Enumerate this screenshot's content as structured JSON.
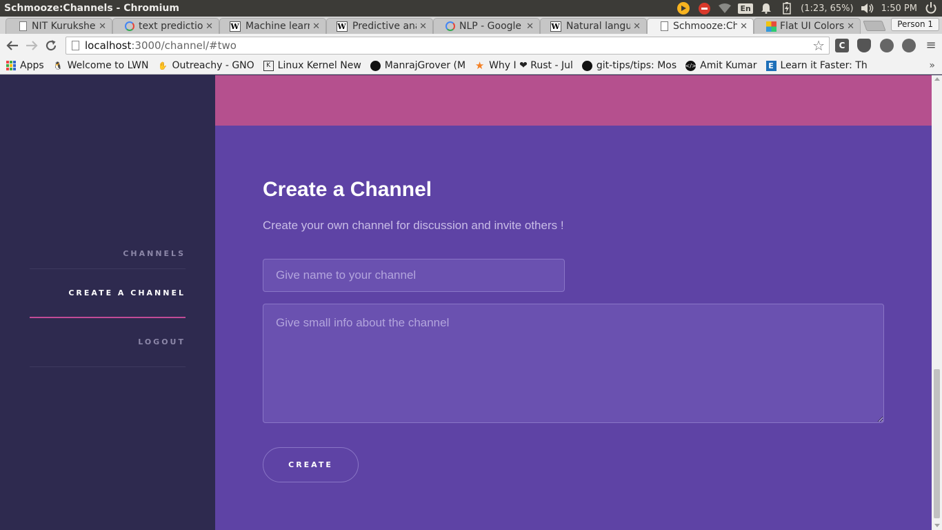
{
  "os": {
    "window_title": "Schmooze:Channels - Chromium",
    "keyboard_layout": "En",
    "battery": "(1:23, 65%)",
    "clock": "1:50 PM",
    "icons": [
      "chrome-icon",
      "stop-icon",
      "wifi-icon",
      "keyboard-icon",
      "bell-icon",
      "battery-icon",
      "volume-icon",
      "power-icon"
    ]
  },
  "browser": {
    "tabs": [
      {
        "title": "NIT Kurukshetr",
        "favicon": "doc-icon",
        "active": false
      },
      {
        "title": "text prediction",
        "favicon": "google-icon",
        "active": false
      },
      {
        "title": "Machine learni",
        "favicon": "wikipedia-icon",
        "active": false
      },
      {
        "title": "Predictive anal",
        "favicon": "wikipedia-icon",
        "active": false
      },
      {
        "title": "NLP - Google S",
        "favicon": "google-icon",
        "active": false
      },
      {
        "title": "Natural langua",
        "favicon": "wikipedia-icon",
        "active": false
      },
      {
        "title": "Schmooze:Cha",
        "favicon": "doc-icon",
        "active": true
      },
      {
        "title": "Flat UI Colors -",
        "favicon": "flatui-icon",
        "active": false
      }
    ],
    "profile": "Person 1",
    "url_host": "localhost",
    "url_path": ":3000/channel/#two",
    "extensions": [
      "C",
      "pocket",
      "circle",
      "circle"
    ],
    "bookmarks": [
      {
        "label": "Apps",
        "icon": "apps-icon"
      },
      {
        "label": "Welcome to LWN",
        "icon": "tux-icon"
      },
      {
        "label": "Outreachy - GNO",
        "icon": "gnome-icon"
      },
      {
        "label": "Linux Kernel New",
        "icon": "kernelnewbies-icon"
      },
      {
        "label": "ManrajGrover (M",
        "icon": "github-icon"
      },
      {
        "label": "Why I ❤ Rust - Jul",
        "icon": "star-icon"
      },
      {
        "label": "git-tips/tips: Mos",
        "icon": "github-icon"
      },
      {
        "label": "Amit Kumar",
        "icon": "code-icon"
      },
      {
        "label": "Learn it Faster: Th",
        "icon": "learnit-icon"
      }
    ]
  },
  "sidebar": {
    "items": [
      {
        "label": "CHANNELS",
        "active": false
      },
      {
        "label": "CREATE A CHANNEL",
        "active": true
      },
      {
        "label": "LOGOUT",
        "active": false
      }
    ]
  },
  "main": {
    "title": "Create a Channel",
    "subtitle": "Create your own channel for discussion and invite others !",
    "name_placeholder": "Give name to your channel",
    "info_placeholder": "Give small info about the channel",
    "create_label": "CREATE"
  },
  "colors": {
    "sidebar_bg": "#2e2a4f",
    "main_bg": "#5e43a5",
    "banner_bg": "#b5508e",
    "active_underline": "#c24b97"
  }
}
